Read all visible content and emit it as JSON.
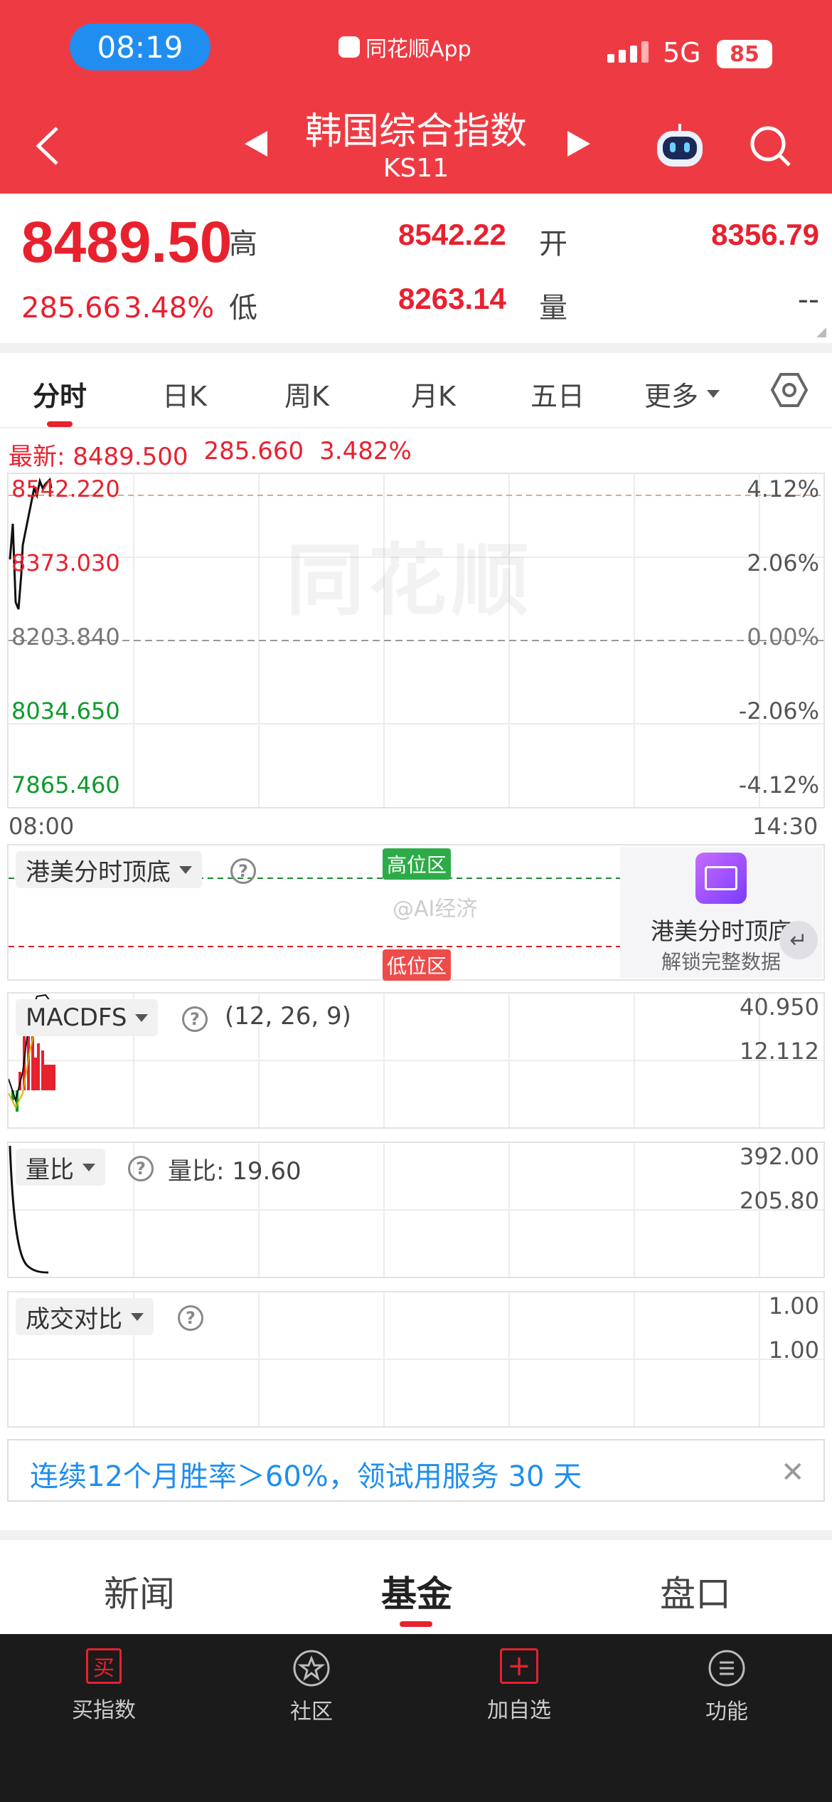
{
  "status": {
    "time": "08:19",
    "carrier_app": "同花顺App",
    "network": "5G",
    "battery": "85"
  },
  "header": {
    "title": "韩国综合指数",
    "code": "KS11"
  },
  "quote": {
    "price": "8489.50",
    "change": "285.66",
    "change_pct": "3.48%",
    "high_label": "高",
    "high": "8542.22",
    "open_label": "开",
    "open": "8356.79",
    "low_label": "低",
    "low": "8263.14",
    "volume_label": "量",
    "volume": "--"
  },
  "tabs": [
    {
      "label": "分时"
    },
    {
      "label": "日K"
    },
    {
      "label": "周K"
    },
    {
      "label": "月K"
    },
    {
      "label": "五日"
    },
    {
      "label": "更多"
    }
  ],
  "latest": {
    "label": "最新:",
    "price": "8489.500",
    "change": "285.660",
    "pct": "3.482%"
  },
  "main_chart": {
    "watermark": "同花顺",
    "y_labels": [
      "8542.220",
      "8373.030",
      "8203.840",
      "8034.650",
      "7865.460"
    ],
    "pct_labels": [
      "4.12%",
      "2.06%",
      "0.00%",
      "-2.06%",
      "-4.12%"
    ],
    "x_start": "08:00",
    "x_end": "14:30"
  },
  "indicator1": {
    "name": "港美分时顶底",
    "high_zone": "高位区",
    "low_zone": "低位区",
    "promo_title": "港美分时顶底",
    "promo_sub": "解锁完整数据",
    "watermark": "@AI经济"
  },
  "macd": {
    "name": "MACDFS",
    "params": "(12, 26, 9)",
    "y_top": "40.950",
    "y_mid": "12.112"
  },
  "ratio": {
    "name": "量比",
    "value_label": "量比: 19.60",
    "y_top": "392.00",
    "y_mid": "205.80"
  },
  "compare": {
    "name": "成交对比",
    "y_top": "1.00",
    "y_mid": "1.00"
  },
  "banner": {
    "text": "连续12个月胜率＞60%，领试用服务 30 天"
  },
  "bottom_tabs": [
    {
      "label": "新闻"
    },
    {
      "label": "基金"
    },
    {
      "label": "盘口"
    }
  ],
  "nav": [
    {
      "label": "买指数",
      "icon_text": "买"
    },
    {
      "label": "社区"
    },
    {
      "label": "加自选"
    },
    {
      "label": "功能"
    }
  ],
  "colors": {
    "header": "#ee3b43",
    "up": "#e8212f",
    "down": "#0e9a2c",
    "accent_blue": "#1f8ef0"
  }
}
